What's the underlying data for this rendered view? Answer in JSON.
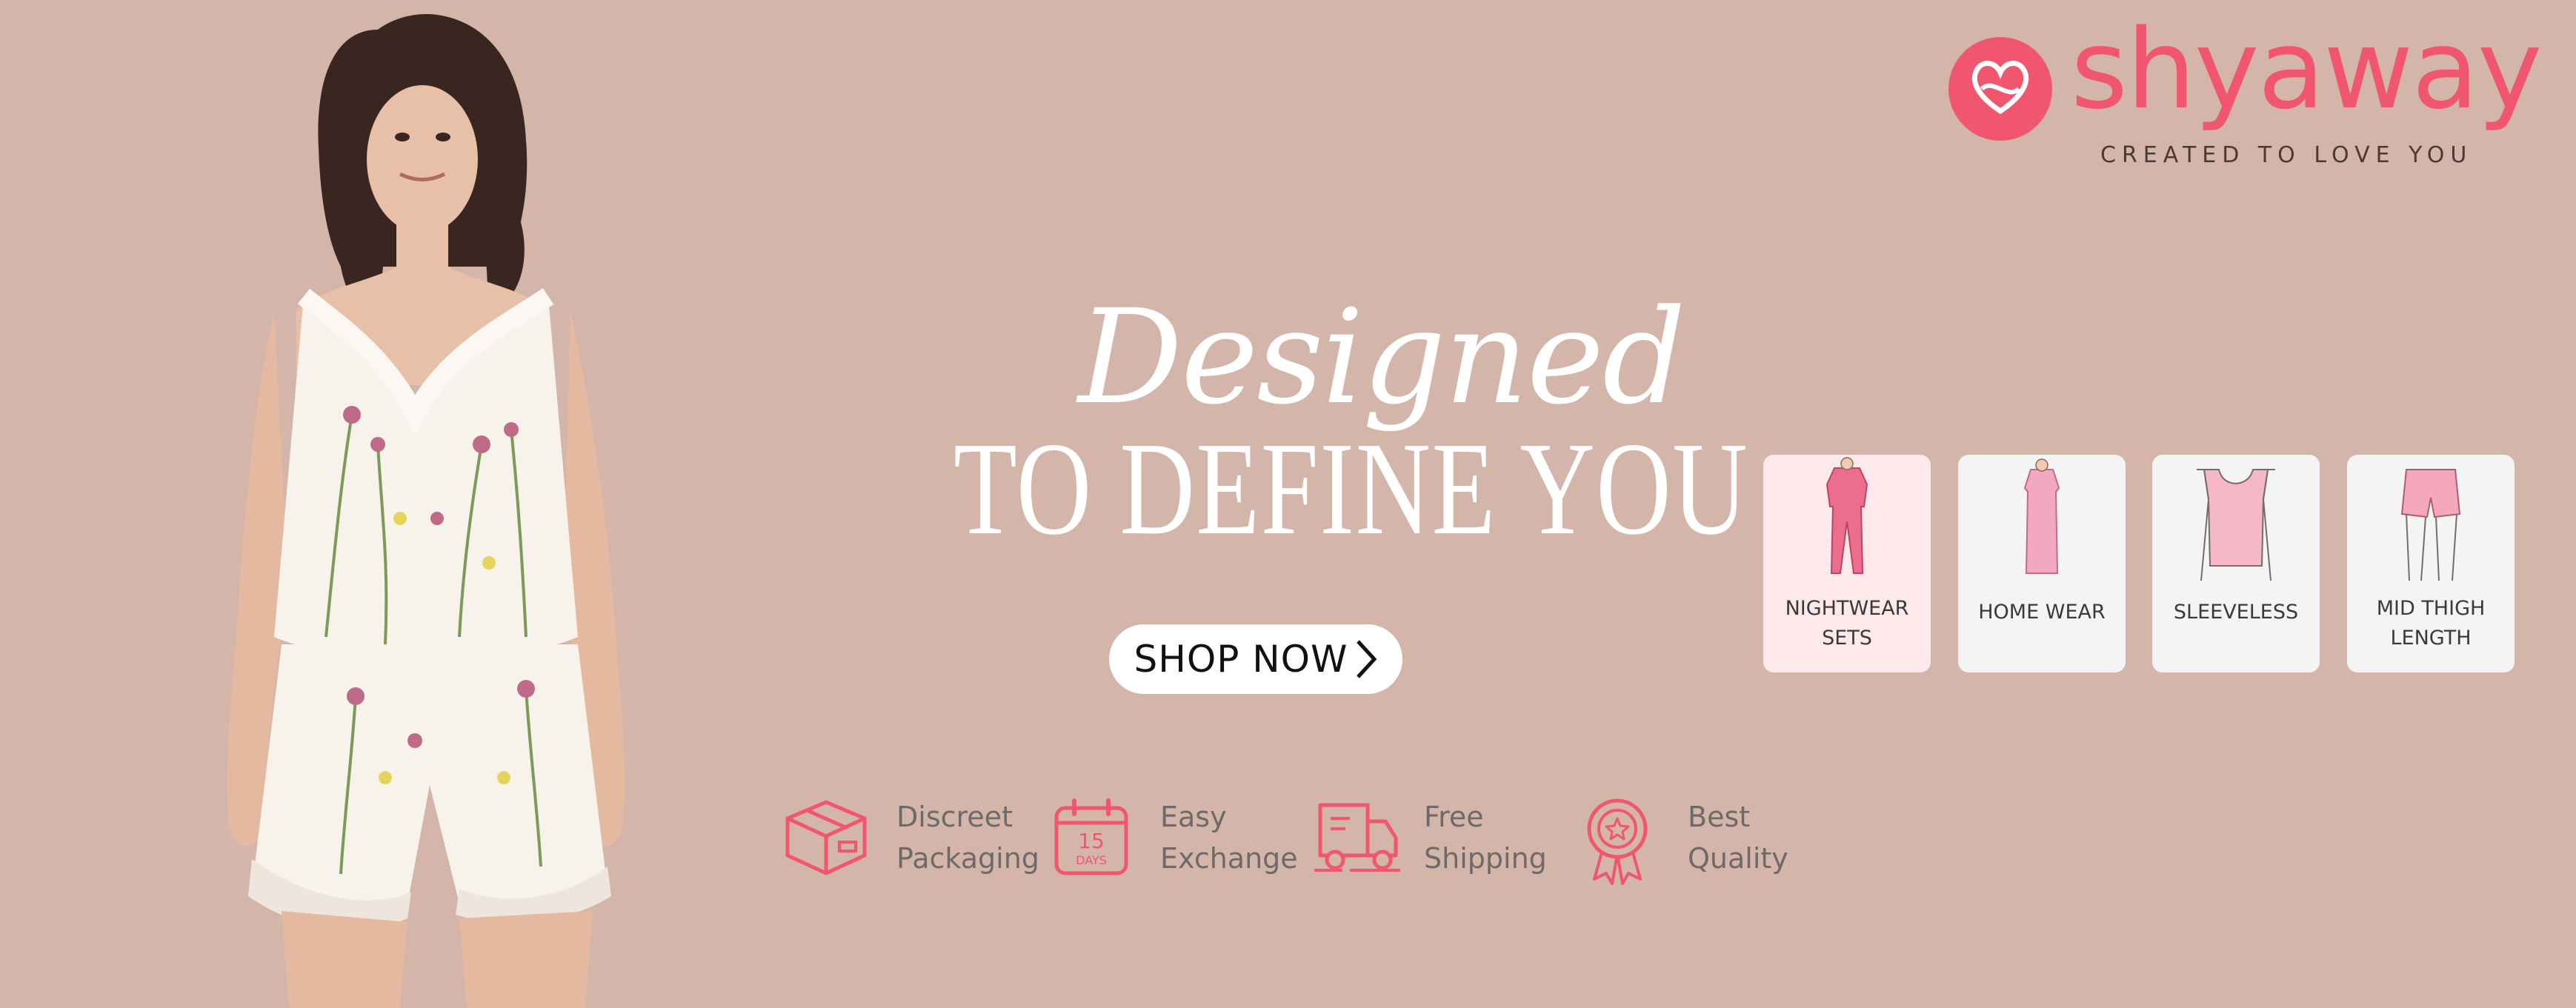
{
  "brand": {
    "name": "shyaway",
    "tagline": "CREATED TO LOVE YOU",
    "color": "#f0566e"
  },
  "colors": {
    "background": "#d4b5aa",
    "accent": "#f0566e",
    "headline": "#ffffff"
  },
  "hero": {
    "script_line": "Designed",
    "headline": "TO DEFINE YOU",
    "cta_label": "SHOP NOW",
    "cta_icon": "chevron-right-icon"
  },
  "categories": [
    {
      "line1": "NIGHTWEAR",
      "line2": "SETS",
      "icon": "nightwear-sets-icon",
      "selected": true
    },
    {
      "line1": "HOME WEAR",
      "line2": "",
      "icon": "home-wear-icon",
      "selected": false
    },
    {
      "line1": "SLEEVELESS",
      "line2": "",
      "icon": "sleeveless-icon",
      "selected": false
    },
    {
      "line1": "MID THIGH",
      "line2": "LENGTH",
      "icon": "mid-thigh-length-icon",
      "selected": false
    }
  ],
  "features": [
    {
      "line1": "Discreet",
      "line2": "Packaging",
      "icon": "package-box-icon"
    },
    {
      "line1": "Easy",
      "line2": "Exchange",
      "icon": "calendar-icon",
      "icon_text_1": "15",
      "icon_text_2": "DAYS"
    },
    {
      "line1": "Free",
      "line2": "Shipping",
      "icon": "delivery-truck-icon"
    },
    {
      "line1": "Best",
      "line2": "Quality",
      "icon": "award-badge-icon"
    }
  ]
}
